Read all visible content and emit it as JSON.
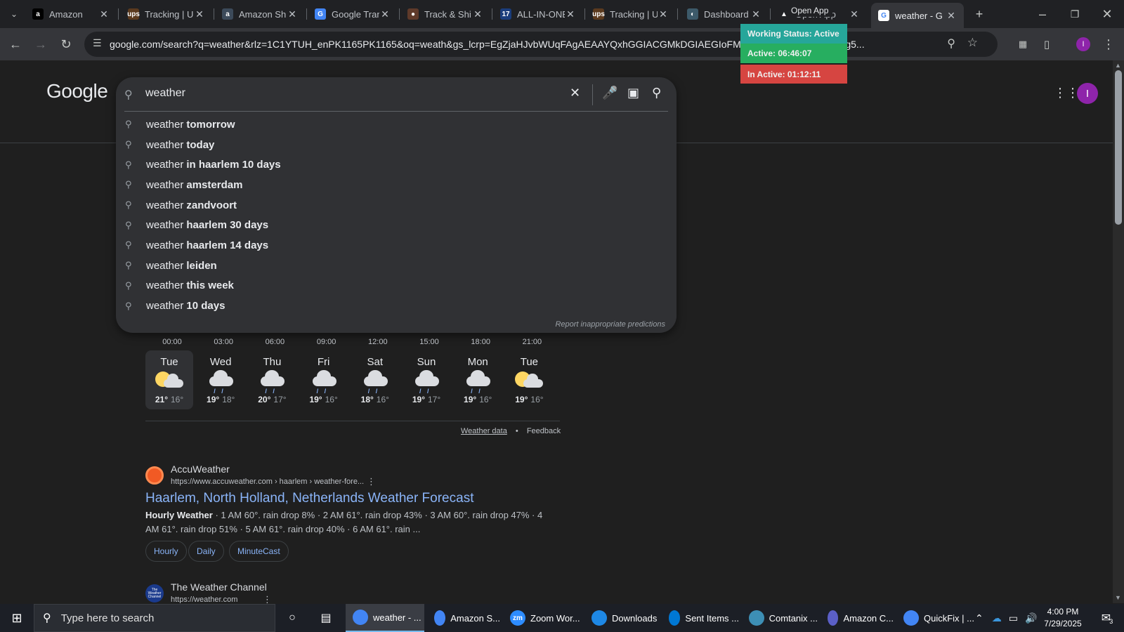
{
  "browser": {
    "tabs": [
      {
        "label": "Amazon",
        "fav": "a",
        "fav_bg": "#000000"
      },
      {
        "label": "Tracking | U",
        "fav": "ups",
        "fav_bg": "#5b3a1e"
      },
      {
        "label": "Amazon Shi",
        "fav": "a",
        "fav_bg": "#3c4a5a"
      },
      {
        "label": "Google Tran",
        "fav": "G",
        "fav_bg": "#4285f4"
      },
      {
        "label": "Track & Shi",
        "fav": "●",
        "fav_bg": "#5f3a2a"
      },
      {
        "label": "ALL-IN-ONE",
        "fav": "17",
        "fav_bg": "#1a3d7c"
      },
      {
        "label": "Tracking | U",
        "fav": "ups",
        "fav_bg": "#5b3a1e"
      },
      {
        "label": "Dashboard",
        "fav": "◐",
        "fav_bg": "#3d5a6a"
      },
      {
        "label": "Open App",
        "fav": "▲",
        "fav_bg": "#202124"
      },
      {
        "label": "weather - G",
        "fav": "G",
        "fav_bg": "#ffffff"
      }
    ],
    "url": "google.com/search?q=weather&rlz=1C1YTUH_enPK1165PK1165&oq=weath&gs_lcrp=EgZjaHJvbWUqFAgAEAAYQxhGGIACGMkDGIAEGIoFMhQI...BiKBTIGCAEQRRg5...",
    "profile_initial": "I"
  },
  "overlay": {
    "open_app": "Open App",
    "working_status": "Working Status: Active",
    "active": "Active: 06:46:07",
    "inactive": "In Active: 01:12:11"
  },
  "google": {
    "logo": "Google",
    "query": "weather",
    "suggestions": [
      {
        "prefix": "weather",
        "bold": "tomorrow"
      },
      {
        "prefix": "weather",
        "bold": "today"
      },
      {
        "prefix": "weather",
        "bold": "in haarlem 10 days"
      },
      {
        "prefix": "weather",
        "bold": "amsterdam"
      },
      {
        "prefix": "weather",
        "bold": "zandvoort"
      },
      {
        "prefix": "weather",
        "bold": "haarlem 30 days"
      },
      {
        "prefix": "weather",
        "bold": "haarlem 14 days"
      },
      {
        "prefix": "weather",
        "bold": "leiden"
      },
      {
        "prefix": "weather",
        "bold": "this week"
      },
      {
        "prefix": "weather",
        "bold": "10 days"
      }
    ],
    "report": "Report inappropriate predictions",
    "profile_initial": "I"
  },
  "forecast": {
    "hours": [
      "00:00",
      "03:00",
      "06:00",
      "09:00",
      "12:00",
      "15:00",
      "18:00",
      "21:00"
    ],
    "days": [
      {
        "name": "Tue",
        "hi": "21°",
        "lo": "16°",
        "icon": "partly-sunny",
        "selected": true
      },
      {
        "name": "Wed",
        "hi": "19°",
        "lo": "18°",
        "icon": "rain"
      },
      {
        "name": "Thu",
        "hi": "20°",
        "lo": "17°",
        "icon": "rain"
      },
      {
        "name": "Fri",
        "hi": "19°",
        "lo": "16°",
        "icon": "rain"
      },
      {
        "name": "Sat",
        "hi": "18°",
        "lo": "16°",
        "icon": "rain"
      },
      {
        "name": "Sun",
        "hi": "19°",
        "lo": "17°",
        "icon": "rain"
      },
      {
        "name": "Mon",
        "hi": "19°",
        "lo": "16°",
        "icon": "rain"
      },
      {
        "name": "Tue",
        "hi": "19°",
        "lo": "16°",
        "icon": "partly-sunny"
      }
    ],
    "weather_data_link": "Weather data",
    "feedback": "Feedback"
  },
  "results": [
    {
      "site": "AccuWeather",
      "url": "https://www.accuweather.com › haarlem › weather-fore...",
      "title": "Haarlem, North Holland, Netherlands Weather Forecast",
      "snippet_bold": "Hourly Weather",
      "snippet": " · 1 AM 60°. rain drop 8% · 2 AM 61°. rain drop 43% · 3 AM 60°. rain drop 47% · 4 AM 61°. rain drop 51% · 5 AM 61°. rain drop 40% · 6 AM 61°. rain ...",
      "chips": [
        "Hourly",
        "Daily",
        "MinuteCast"
      ],
      "fav_color": "#f15a24"
    },
    {
      "site": "The Weather Channel",
      "url": "https://weather.com",
      "fav_color": "#1a3a8c",
      "fav_text": "The Weather Channel"
    }
  ],
  "taskbar": {
    "search_placeholder": "Type here to search",
    "apps": [
      {
        "label": "weather - ...",
        "icon": "chrome-icon",
        "color": "#4285f4",
        "active": true
      },
      {
        "label": "Amazon S...",
        "icon": "chrome-icon",
        "color": "#4285f4"
      },
      {
        "label": "Zoom Wor...",
        "icon": "zoom-icon",
        "color": "#2d8cff",
        "text": "zm"
      },
      {
        "label": "Downloads",
        "icon": "download-icon",
        "color": "#1e88e5"
      },
      {
        "label": "Sent Items ...",
        "icon": "outlook-icon",
        "color": "#0078d4"
      },
      {
        "label": "Comtanix ...",
        "icon": "comtanix-icon",
        "color": "#3d8fb5"
      },
      {
        "label": "Amazon C...",
        "icon": "teams-icon",
        "color": "#5b5fc7"
      },
      {
        "label": "QuickFix | ...",
        "icon": "chrome-icon",
        "color": "#4285f4"
      }
    ],
    "time": "4:00 PM",
    "date": "7/29/2025",
    "notification_count": "3"
  }
}
